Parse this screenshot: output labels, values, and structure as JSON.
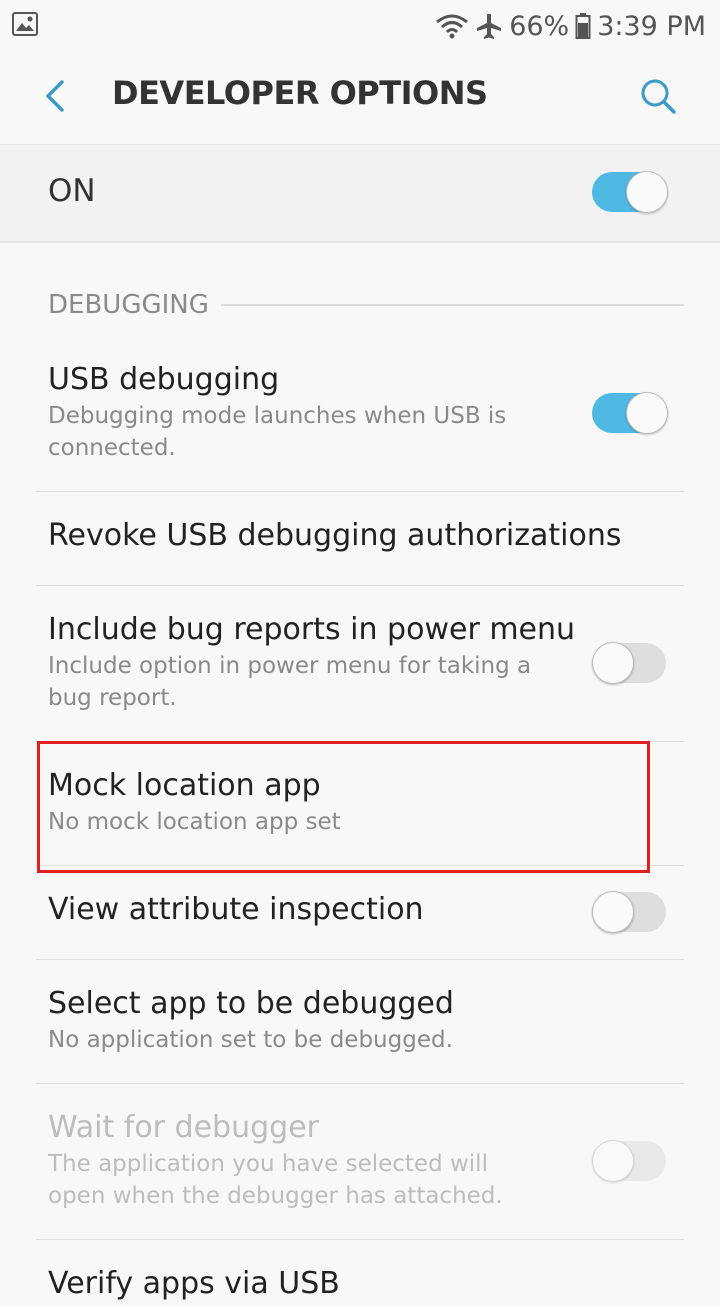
{
  "status_bar": {
    "battery": "66%",
    "time": "3:39 PM",
    "icons": [
      "gallery-icon",
      "wifi-icon",
      "airplane-icon",
      "battery-icon"
    ]
  },
  "header": {
    "title": "DEVELOPER OPTIONS",
    "back_icon": "back-chevron-icon",
    "search_icon": "search-icon"
  },
  "master": {
    "label": "ON",
    "enabled": true
  },
  "section": {
    "label": "DEBUGGING"
  },
  "items": [
    {
      "title": "USB debugging",
      "subtitle": "Debugging mode launches when USB is connected.",
      "toggle": "on"
    },
    {
      "title": "Revoke USB debugging authorizations"
    },
    {
      "title": "Include bug reports in power menu",
      "subtitle": "Include option in power menu for taking a bug report.",
      "toggle": "off"
    },
    {
      "title": "Mock location app",
      "subtitle": "No mock location app set"
    },
    {
      "title": "View attribute inspection",
      "toggle": "off"
    },
    {
      "title": "Select app to be debugged",
      "subtitle": "No application set to be debugged."
    },
    {
      "title": "Wait for debugger",
      "subtitle": "The application you have selected will open when the debugger has attached.",
      "toggle": "off",
      "disabled": true
    },
    {
      "title": "Verify apps via USB"
    }
  ],
  "colors": {
    "accent": "#4fb9e3",
    "highlight": "#e02020",
    "background": "#f8f8f8"
  }
}
